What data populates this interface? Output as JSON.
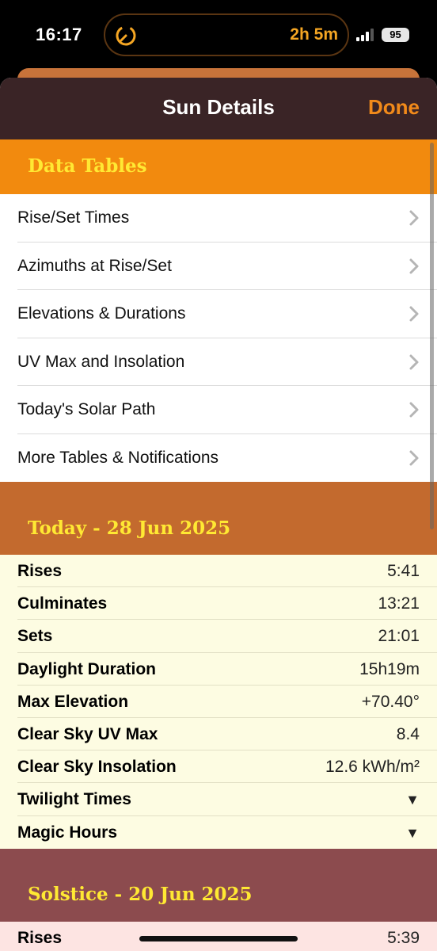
{
  "status_bar": {
    "time": "16:17",
    "timer": "2h 5m",
    "battery": "95"
  },
  "navbar": {
    "title": "Sun Details",
    "done_label": "Done"
  },
  "data_tables": {
    "header": "Data Tables",
    "items": [
      {
        "label": "Rise/Set Times"
      },
      {
        "label": "Azimuths at Rise/Set"
      },
      {
        "label": "Elevations & Durations"
      },
      {
        "label": "UV Max and Insolation"
      },
      {
        "label": "Today's Solar Path"
      },
      {
        "label": "More Tables & Notifications"
      }
    ]
  },
  "today": {
    "header": "Today - 28 Jun 2025",
    "rows": [
      {
        "key": "Rises",
        "value": "5:41"
      },
      {
        "key": "Culminates",
        "value": "13:21"
      },
      {
        "key": "Sets",
        "value": "21:01"
      },
      {
        "key": "Daylight Duration",
        "value": "15h19m"
      },
      {
        "key": "Max Elevation",
        "value": "+70.40°"
      },
      {
        "key": "Clear Sky UV Max",
        "value": "8.4"
      },
      {
        "key": "Clear Sky Insolation",
        "value": "12.6 kWh/m²"
      },
      {
        "key": "Twilight Times",
        "value": "▼"
      },
      {
        "key": "Magic Hours",
        "value": "▼"
      }
    ]
  },
  "solstice": {
    "header": "Solstice - 20 Jun 2025",
    "rows": [
      {
        "key": "Rises",
        "value": "5:39"
      }
    ]
  },
  "colors": {
    "accent": "#f18a1a",
    "navbar_bg": "#3a2426",
    "data_header_bg": "#f28a0e",
    "today_header_bg": "#c36a2e",
    "solstice_header_bg": "#8c4b4e",
    "header_text": "#ffe933"
  }
}
